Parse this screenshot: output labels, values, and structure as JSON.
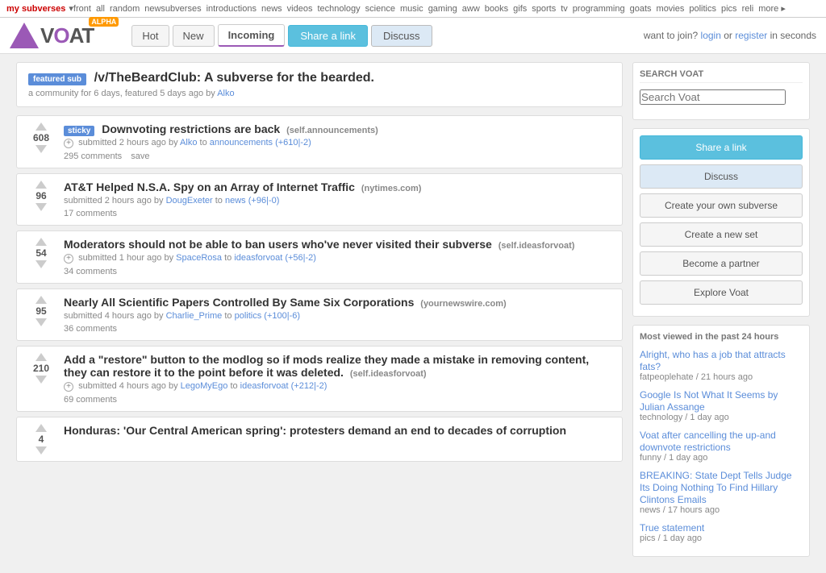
{
  "topnav": {
    "my_subverses": "my subverses",
    "links": [
      "front",
      "all",
      "random",
      "newsubverses",
      "introductions",
      "news",
      "videos",
      "technology",
      "science",
      "music",
      "gaming",
      "aww",
      "books",
      "gifs",
      "sports",
      "tv",
      "programming",
      "goats",
      "movies",
      "politics",
      "pics",
      "reli",
      "more"
    ]
  },
  "header": {
    "logo_text": "AT",
    "alpha": "ALPHA",
    "tabs": [
      {
        "label": "Hot",
        "active": false
      },
      {
        "label": "New",
        "active": false
      },
      {
        "label": "Incoming",
        "active": true
      }
    ],
    "share_label": "Share a link",
    "discuss_label": "Discuss",
    "join_text": "want to join?",
    "login_label": "login",
    "or_text": "or",
    "register_label": "register",
    "seconds_text": "in seconds"
  },
  "featured": {
    "badge": "featured sub",
    "title": "/v/TheBeardClub: A subverse for the bearded.",
    "info": "a community for 6 days, featured 5 days ago by",
    "user": "Alko"
  },
  "posts": [
    {
      "id": 1,
      "sticky": true,
      "votes": "608",
      "title": "Downvoting restrictions are back",
      "domain": "(self.announcements)",
      "meta_prefix": "submitted 2 hours ago by",
      "author": "Alko",
      "to_text": "to",
      "subverse": "announcements",
      "score": "(+610|-2)",
      "comments_label": "295 comments",
      "save_label": "save"
    },
    {
      "id": 2,
      "sticky": false,
      "votes": "96",
      "title": "AT&T Helped N.S.A. Spy on an Array of Internet Traffic",
      "domain": "(nytimes.com)",
      "meta_prefix": "submitted 2 hours ago by",
      "author": "DougExeter",
      "to_text": "to",
      "subverse": "news",
      "score": "(+96|-0)",
      "comments_label": "17 comments"
    },
    {
      "id": 3,
      "sticky": false,
      "votes": "54",
      "title": "Moderators should not be able to ban users who've never visited their subverse",
      "domain": "(self.ideasforvoat)",
      "meta_prefix": "submitted 1 hour ago by",
      "author": "SpaceRosa",
      "to_text": "to",
      "subverse": "ideasforvoat",
      "score": "(+56|-2)",
      "comments_label": "34 comments"
    },
    {
      "id": 4,
      "sticky": false,
      "votes": "95",
      "title": "Nearly All Scientific Papers Controlled By Same Six Corporations",
      "domain": "(yournewswire.com)",
      "meta_prefix": "submitted 4 hours ago by",
      "author": "Charlie_Prime",
      "to_text": "to",
      "subverse": "politics",
      "score": "(+100|-6)",
      "comments_label": "36 comments"
    },
    {
      "id": 5,
      "sticky": false,
      "votes": "210",
      "title": "Add a \"restore\" button to the modlog so if mods realize they made a mistake in removing content, they can restore it to the point before it was deleted.",
      "domain": "(self.ideasforvoat)",
      "meta_prefix": "submitted 4 hours ago by",
      "author": "LegoMyEgo",
      "to_text": "to",
      "subverse": "ideasforvoat",
      "score": "(+212|-2)",
      "comments_label": "69 comments"
    },
    {
      "id": 6,
      "sticky": false,
      "votes": "4",
      "title": "Honduras: 'Our Central American spring': protesters demand an end to decades of corruption",
      "domain": "",
      "meta_prefix": "",
      "author": "",
      "to_text": "",
      "subverse": "",
      "score": "",
      "comments_label": ""
    }
  ],
  "sidebar": {
    "search_title": "Search Voat",
    "search_placeholder": "Search Voat",
    "share_label": "Share a link",
    "discuss_label": "Discuss",
    "create_subverse_label": "Create your own subverse",
    "create_set_label": "Create a new set",
    "partner_label": "Become a partner",
    "explore_label": "Explore Voat",
    "most_viewed_title": "Most viewed in the past 24 hours",
    "trending": [
      {
        "title": "Alright, who has a job that attracts fats?",
        "sub": "fatpeoplehate",
        "time": "21 hours ago"
      },
      {
        "title": "Google Is Not What It Seems  by Julian Assange",
        "sub": "technology",
        "time": "1 day ago"
      },
      {
        "title": "Voat after cancelling the up-and downvote restrictions",
        "sub": "funny",
        "time": "1 day ago"
      },
      {
        "title": "BREAKING: State Dept Tells Judge Its Doing Nothing To Find Hillary Clintons Emails",
        "sub": "news",
        "time": "17 hours ago"
      },
      {
        "title": "True statement",
        "sub": "pics",
        "time": "1 day ago"
      }
    ]
  }
}
